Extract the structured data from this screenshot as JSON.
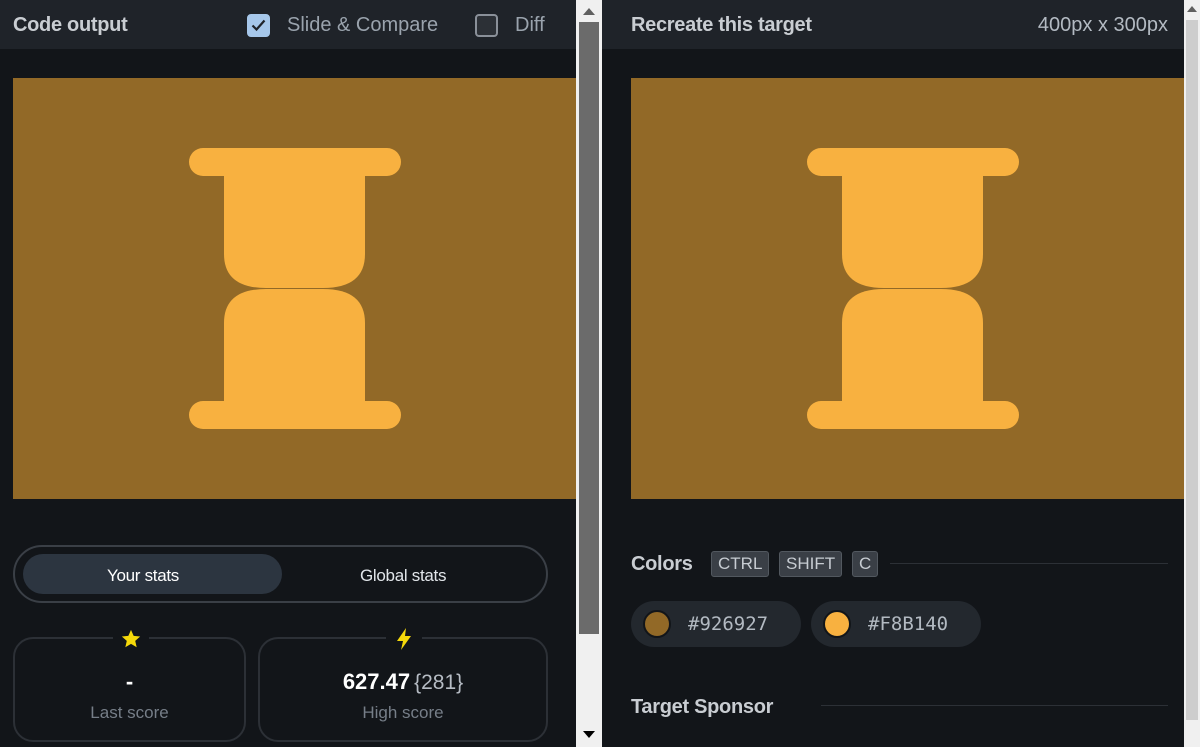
{
  "left_panel": {
    "title": "Code output",
    "slide_compare": {
      "label": "Slide & Compare",
      "checked": true
    },
    "diff": {
      "label": "Diff",
      "checked": false
    },
    "stats_toggle": {
      "your_stats": "Your stats",
      "global_stats": "Global stats",
      "selected": "Your stats"
    },
    "last_score": {
      "value": "-",
      "label": "Last score",
      "icon": "star-icon"
    },
    "high_score": {
      "value": "627.47",
      "extra": "{281}",
      "label": "High score",
      "icon": "bolt-icon"
    }
  },
  "right_panel": {
    "title": "Recreate this target",
    "size": "400px x 300px",
    "colors_label": "Colors",
    "shortcut_keys": [
      "CTRL",
      "SHIFT",
      "C"
    ],
    "colors": [
      {
        "hex": "#926927",
        "label": "#926927"
      },
      {
        "hex": "#F8B140",
        "label": "#F8B140"
      }
    ],
    "sponsor_label": "Target Sponsor"
  },
  "theme": {
    "background": "#121519",
    "header": "#1f2329",
    "canvas_background": "#926927",
    "shape_color": "#F8B140",
    "accent_star": "#f5d90a",
    "checkbox_checked": "#a6c7ea"
  }
}
